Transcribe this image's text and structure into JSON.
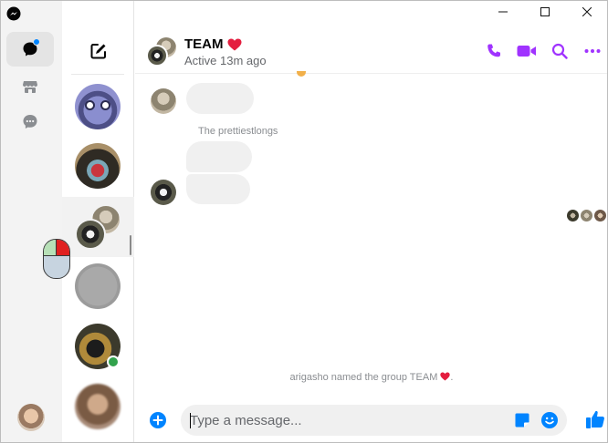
{
  "window": {
    "controls": {
      "minimize": "—",
      "maximize": "☐",
      "close": "✕"
    }
  },
  "colors": {
    "accent": "#a033ff",
    "messenger_blue": "#0084ff",
    "online": "#31a24c",
    "heart": "#e41e3f"
  },
  "rail": {
    "items": [
      {
        "name": "chats",
        "icon": "chat-bubble-icon",
        "active": true,
        "has_badge": true
      },
      {
        "name": "marketplace",
        "icon": "store-icon",
        "active": false
      },
      {
        "name": "requests",
        "icon": "chat-dots-icon",
        "active": false
      }
    ]
  },
  "conversations": [
    {
      "kind": "cartoon-avatar"
    },
    {
      "kind": "photo-avatar"
    },
    {
      "kind": "group-avatar",
      "selected": true
    },
    {
      "kind": "gray-avatar"
    },
    {
      "kind": "photo-avatar",
      "online": true
    },
    {
      "kind": "photo-avatar-blurred"
    }
  ],
  "header": {
    "title": "TEAM",
    "subtitle": "Active 13m ago",
    "actions": [
      "phone-icon",
      "video-icon",
      "search-icon",
      "more-icon"
    ]
  },
  "thread": {
    "sender_name": "The prettiestlongs",
    "system_message": "arigasho named the group TEAM",
    "system_message_end": "."
  },
  "composer": {
    "placeholder": "Type a message..."
  }
}
